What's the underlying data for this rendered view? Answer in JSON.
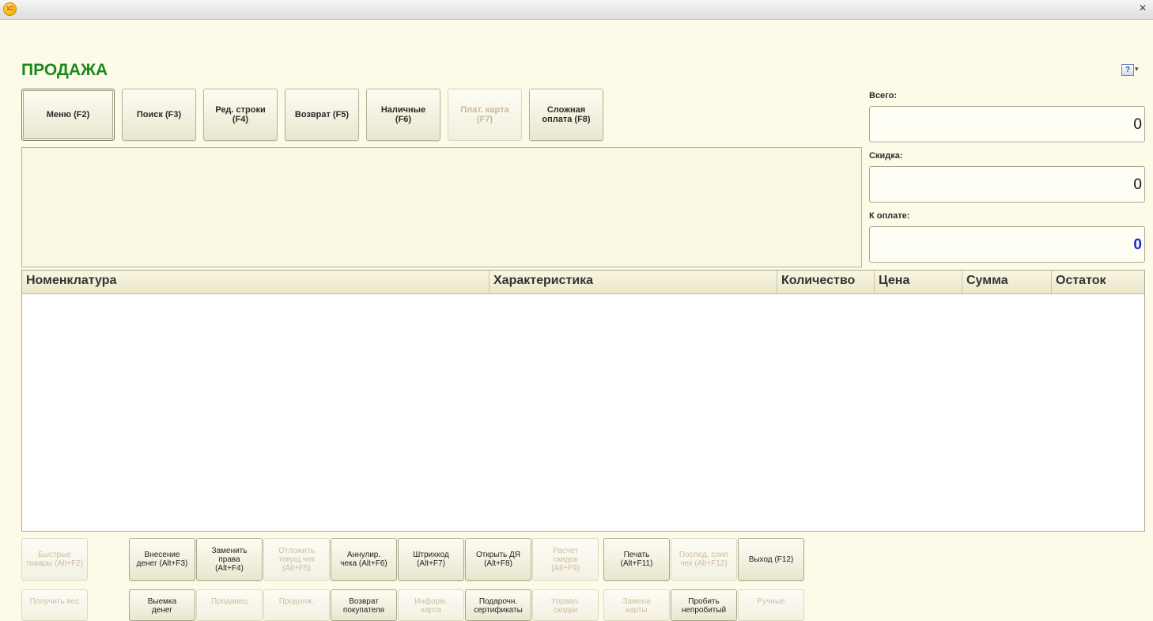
{
  "window": {
    "logo_text": "1С",
    "close_glyph": "×"
  },
  "title": "ПРОДАЖА",
  "help": {
    "icon_glyph": "?",
    "arrow_glyph": "▾"
  },
  "toolbar": [
    {
      "label": "Меню (F2)",
      "disabled": false
    },
    {
      "label": "Поиск (F3)",
      "disabled": false
    },
    {
      "label": "Ред. строки\n(F4)",
      "disabled": false
    },
    {
      "label": "Возврат (F5)",
      "disabled": false
    },
    {
      "label": "Наличные\n(F6)",
      "disabled": false
    },
    {
      "label": "Плат. карта\n(F7)",
      "disabled": true
    },
    {
      "label": "Сложная\nоплата (F8)",
      "disabled": false
    }
  ],
  "summary": {
    "total_label": "Всего:",
    "total_value": "0",
    "discount_label": "Скидка:",
    "discount_value": "0",
    "to_pay_label": "К оплате:",
    "to_pay_value": "0"
  },
  "table": {
    "columns": [
      "Номенклатура",
      "Характеристика",
      "Количество",
      "Цена",
      "Сумма",
      "Остаток"
    ],
    "rows": []
  },
  "actions_row1": [
    {
      "label": "Быстрые\nтовары (Alt+F2)",
      "disabled": true
    },
    {
      "label": "Внесение\nденег (Alt+F3)",
      "disabled": false
    },
    {
      "label": "Заменить\nправа\n(Alt+F4)",
      "disabled": false
    },
    {
      "label": "Отложить\nтекущ.чек\n(Alt+F5)",
      "disabled": true
    },
    {
      "label": "Аннулир.\nчека (Alt+F6)",
      "disabled": false
    },
    {
      "label": "Штрихкод\n(Alt+F7)",
      "disabled": false
    },
    {
      "label": "Открыть ДЯ\n(Alt+F8)",
      "disabled": false
    },
    {
      "label": "Расчет\nскидок\n(Alt+F9)",
      "disabled": true
    },
    {
      "label": "Печать\n(Alt+F11)",
      "disabled": false
    },
    {
      "label": "Послед. слип\nчек (Alt+F12)",
      "disabled": true
    },
    {
      "label": "Выход (F12)",
      "disabled": false
    }
  ],
  "actions_row2": [
    {
      "label": "Получить вес",
      "disabled": true
    },
    {
      "label": "Выемка\nденег",
      "disabled": false
    },
    {
      "label": "Продавец",
      "disabled": true
    },
    {
      "label": "Продолж.",
      "disabled": true
    },
    {
      "label": "Возврат\nпокупателя",
      "disabled": false
    },
    {
      "label": "Информ.\nкарта",
      "disabled": true
    },
    {
      "label": "Подарочн.\nсертификаты",
      "disabled": false
    },
    {
      "label": "Управл.\nскидки",
      "disabled": true
    },
    {
      "label": "Замена\nкарты",
      "disabled": true
    },
    {
      "label": "Пробить\nнепробитый",
      "disabled": false
    },
    {
      "label": "Ручные",
      "disabled": true
    }
  ]
}
